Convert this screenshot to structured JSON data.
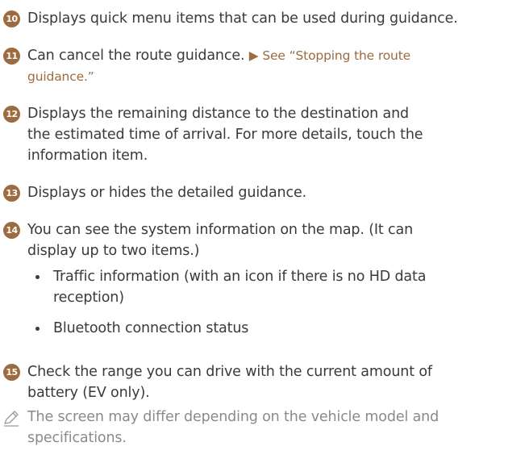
{
  "items": [
    {
      "number": "10",
      "text": "Displays quick menu items that can be used during guidance."
    },
    {
      "number": "11",
      "text": "Can cancel the route guidance. ",
      "ref": "▶ See “Stopping the route",
      "ref_cont": "guidance.”"
    },
    {
      "number": "12",
      "lines": [
        "Displays the remaining distance to the destination and",
        "the estimated time of arrival. For more details, touch the",
        "information item."
      ]
    },
    {
      "number": "13",
      "text": "Displays or hides the detailed guidance."
    },
    {
      "number": "14",
      "lines": [
        "You can see the system information on the map. (It can",
        "display up to two items.)"
      ]
    },
    {
      "number": "15",
      "lines": [
        "Check the range you can drive with the current amount of",
        "battery (EV only)."
      ]
    }
  ],
  "bullets": [
    {
      "lines": [
        "Traffic information (with an icon if there is no HD data",
        "reception)"
      ]
    },
    {
      "lines": [
        "Bluetooth connection status"
      ]
    }
  ],
  "note": {
    "icon": "pencil-note-icon",
    "lines": [
      "The screen may differ depending on the vehicle model and",
      "specifications."
    ]
  },
  "colors": {
    "accent": "#9c6b3f",
    "text": "#3a3a3a",
    "note": "#8a8a8a"
  }
}
